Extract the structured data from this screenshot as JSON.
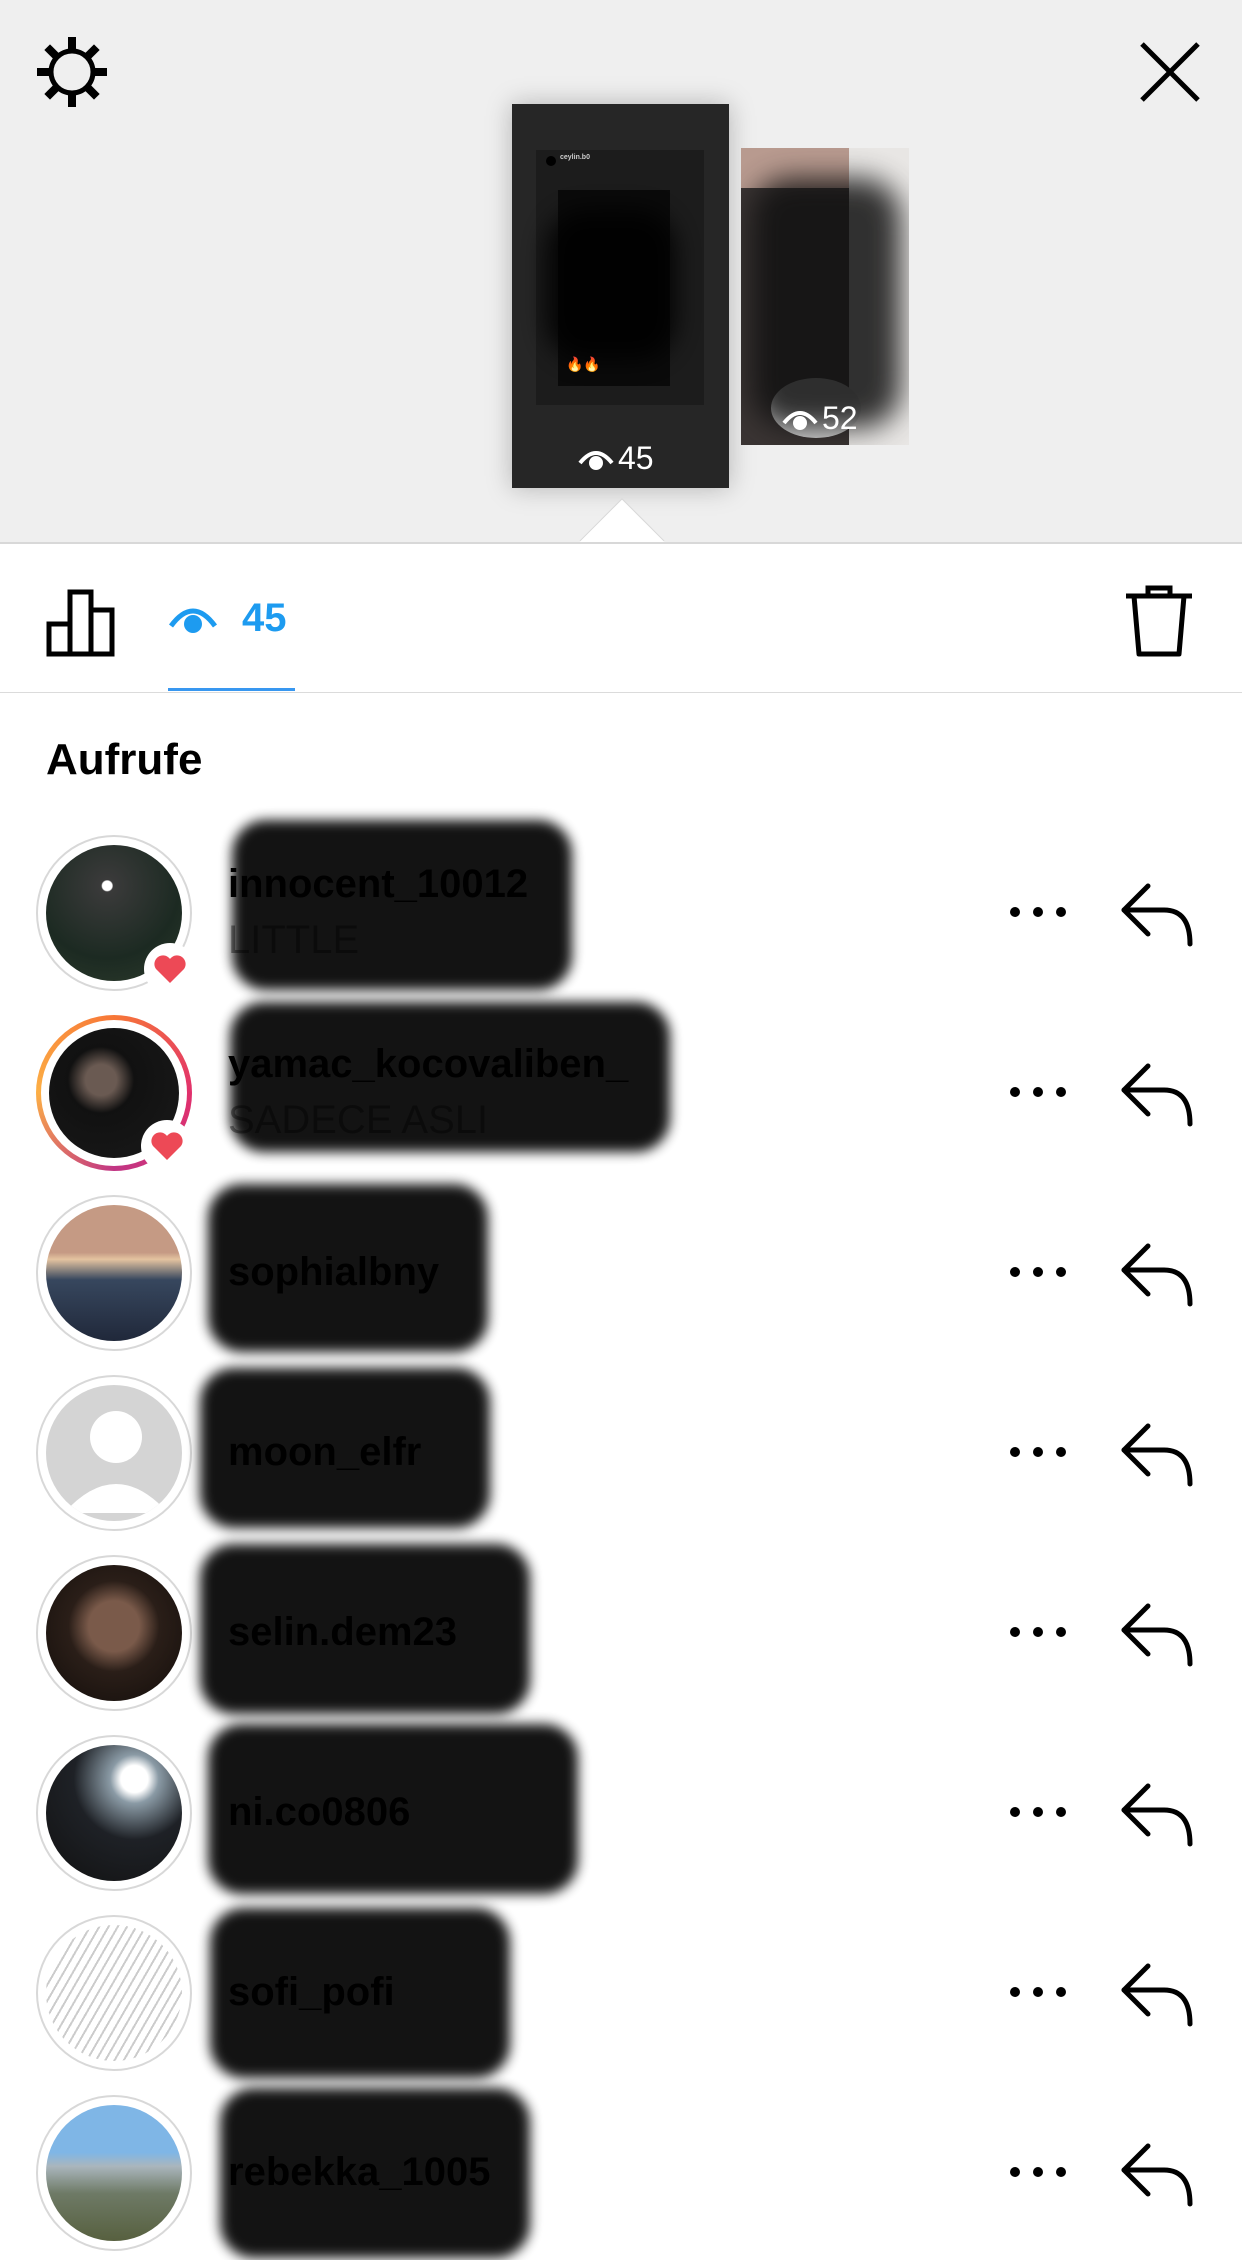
{
  "top": {
    "settings_icon": "gear-icon",
    "close_icon": "close-icon",
    "stories": [
      {
        "username": "ceylin.b0",
        "views": "45",
        "selected": true
      },
      {
        "views": "52",
        "selected": false
      }
    ]
  },
  "stats": {
    "insights_icon": "bar-chart-icon",
    "viewer_count": "45",
    "delete_icon": "trash-icon",
    "accent": "#1d9bf0"
  },
  "viewers": {
    "title": "Aufrufe",
    "items": [
      {
        "username": "innocent_10012",
        "subtitle": "LITTLE",
        "liked": true
      },
      {
        "username": "yamac_kocovaliben_",
        "subtitle": "SADECE ASLI",
        "liked": true
      },
      {
        "username": "sophialbny",
        "subtitle": "",
        "liked": false
      },
      {
        "username": "moon_elfr",
        "subtitle": "",
        "liked": false
      },
      {
        "username": "selin.dem23",
        "subtitle": "",
        "liked": false
      },
      {
        "username": "ni.co0806",
        "subtitle": "",
        "liked": false
      },
      {
        "username": "sofi_pofi",
        "subtitle": "",
        "liked": false
      },
      {
        "username": "rebekka_1005",
        "subtitle": "",
        "liked": false
      }
    ],
    "more_icon": "more-icon",
    "reply_icon": "reply-icon",
    "heart_color": "#ed4956"
  }
}
